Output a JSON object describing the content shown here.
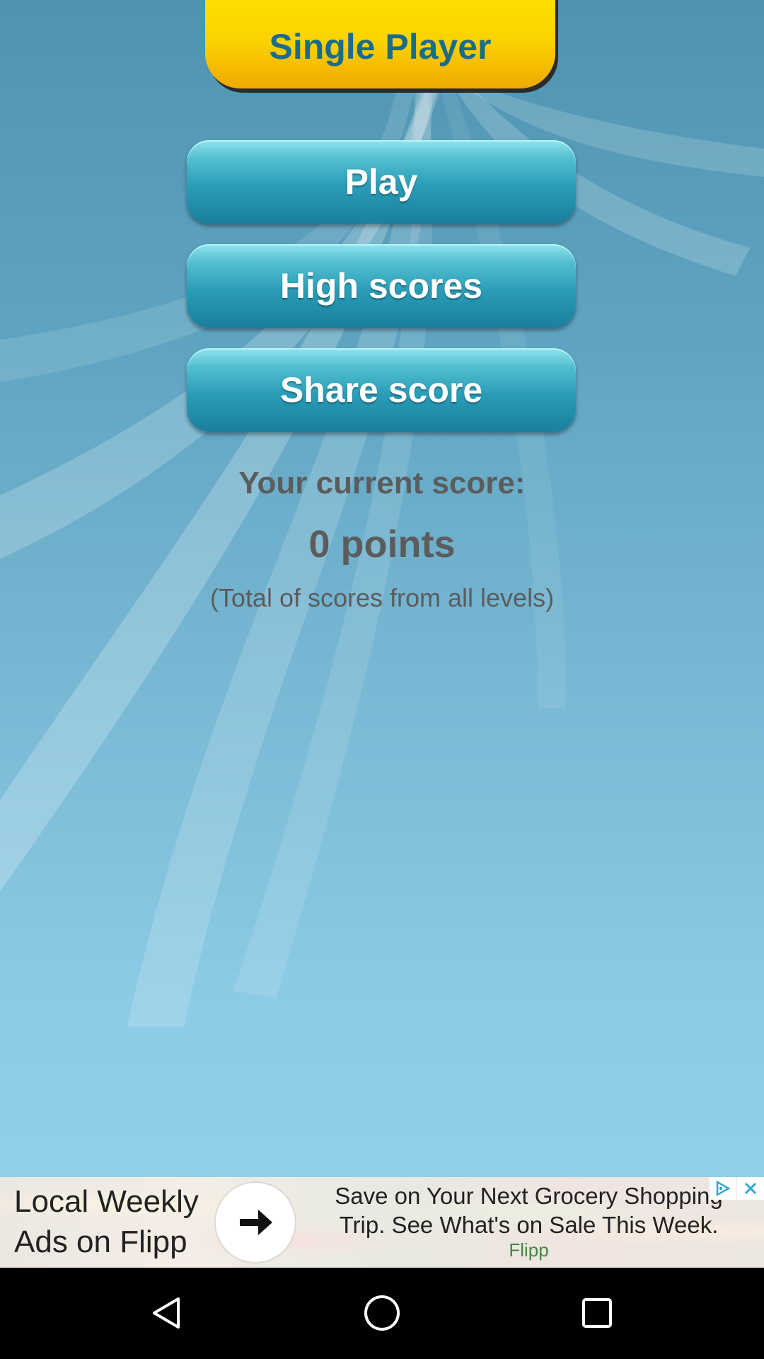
{
  "title_tab": {
    "label": "Single Player"
  },
  "menu": {
    "play_label": "Play",
    "high_scores_label": "High scores",
    "share_score_label": "Share score"
  },
  "score": {
    "heading": "Your current score:",
    "value": "0 points",
    "note": "(Total of scores from all levels)"
  },
  "ad": {
    "left_line1": "Local Weekly",
    "left_line2": "Ads on Flipp",
    "right_line1": "Save on Your Next Grocery Shopping",
    "right_line2": "Trip. See What's on Sale This Week.",
    "brand": "Flipp",
    "arrow_icon": "arrow-right-icon",
    "adchoices_icon": "adchoices-icon",
    "close_icon": "close-icon"
  },
  "navbar": {
    "back_icon": "back-triangle-icon",
    "home_icon": "home-circle-icon",
    "recents_icon": "recents-square-icon"
  },
  "colors": {
    "title_text": "#1a6c8c",
    "title_tab": "#fbd200",
    "button": "#2a9db7",
    "score_text": "#5c5c5c",
    "ad_brand": "#3d8a3d"
  }
}
